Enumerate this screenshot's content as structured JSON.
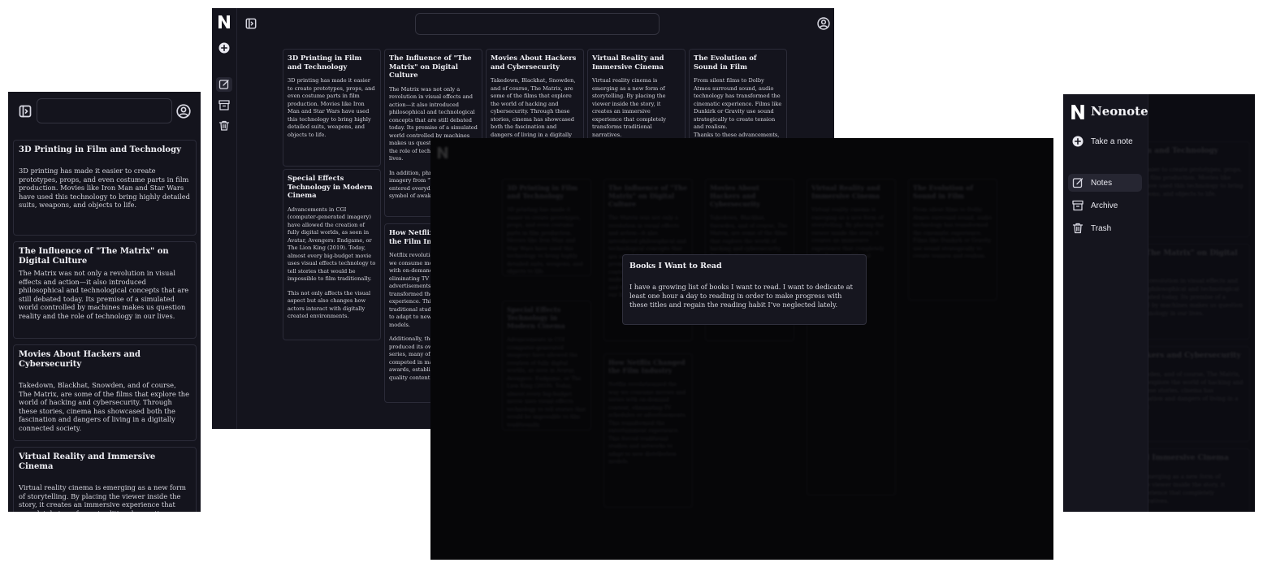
{
  "app": {
    "name": "Neonote",
    "logo_letter": "N"
  },
  "sidebar": {
    "take_note": "Take a note",
    "items": [
      {
        "label": "Notes",
        "icon": "notes-icon",
        "active": true
      },
      {
        "label": "Archive",
        "icon": "archive-icon"
      },
      {
        "label": "Trash",
        "icon": "trash-icon"
      }
    ]
  },
  "search": {
    "placeholder": ""
  },
  "notes": [
    {
      "title": "3D Printing in Film and Technology",
      "body": "3D printing has made it easier to create prototypes, props, and even costume parts in film production. Movies like Iron Man and Star Wars have used this technology to bring highly detailed suits, weapons, and objects to life."
    },
    {
      "title": "The Influence of \"The Matrix\" on Digital Culture",
      "body": "The Matrix was not only a revolution in visual effects and action—it also introduced philosophical and technological concepts that are still debated today. Its premise of a simulated world controlled by machines makes us question reality and the role of technology in our lives.",
      "body2": "In addition, phrases and imagery from \"The Matrix\" have entered everyday language as a symbol of awakening to reality."
    },
    {
      "title": "Movies About Hackers and Cybersecurity",
      "body": "Takedown, Blackhat, Snowden, and of course, The Matrix, are some of the films that explore the world of hacking and cybersecurity. Through these stories, cinema has showcased both the fascination and dangers of living in a digitally connected society."
    },
    {
      "title": "Virtual Reality and Immersive Cinema",
      "body": "Virtual reality cinema is emerging as a new form of storytelling. By placing the viewer inside the story, it creates an immersive experience that completely transforms traditional narratives."
    },
    {
      "title": "The Evolution of Sound in Film",
      "body": "From silent films to Dolby Atmos surround sound, audio technology has transformed the cinematic experience. Films like Dunkirk or Gravity use sound strategically to create tension and realism.",
      "body2": "Thanks to these advancements, sound has become a key element of storytelling."
    },
    {
      "title": "Special Effects Technology in Modern Cinema",
      "body": "Advancements in CGI (computer-generated imagery) have allowed the creation of fully digital worlds, as seen in Avatar, Avengers: Endgame, or The Lion King (2019). Today, almost every big-budget movie uses visual effects technology to tell stories that would be impossible to film traditionally.",
      "body2": "This not only affects the visual aspect but also changes how actors interact with digitally created environments."
    },
    {
      "title": "How Netflix Changed the Film Industry",
      "body": "Netflix revolutionized the way we consume movies and series with on-demand content, eliminating TV schedules or advertisements. This transformed the entertainment experience. This forced traditional studios and networks to adapt to new distribution models.",
      "body2": "Additionally, the platform has produced its own films and series, many of which have competed in major festivals and awards, establishing itself as a quality content creator."
    }
  ],
  "modal": {
    "title": "Books I Want to Read",
    "body": "I have a growing list of books I want to read.  I want to dedicate at least one hour a day to reading in order to make progress with these titles and regain the reading habit I’ve neglected lately."
  },
  "colors": {
    "panel_bg": "#14141d",
    "modal_bg": "#16161f",
    "border": "#2b2b38",
    "active_nav": "#262632"
  }
}
